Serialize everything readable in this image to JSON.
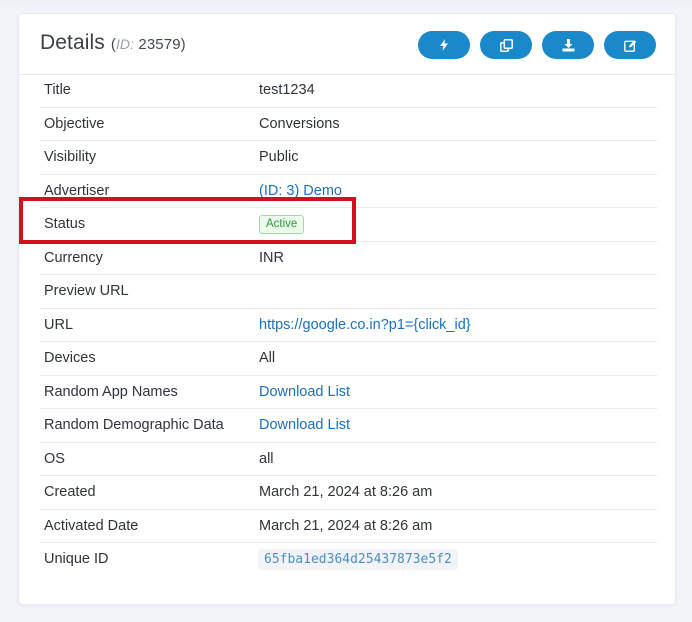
{
  "header": {
    "title": "Details",
    "id_label": "ID:",
    "id_value": "23579",
    "buttons": [
      {
        "name": "bolt-button",
        "icon": "bolt-icon"
      },
      {
        "name": "copy-button",
        "icon": "copy-icon"
      },
      {
        "name": "download-button",
        "icon": "download-icon"
      },
      {
        "name": "edit-button",
        "icon": "edit-icon"
      }
    ]
  },
  "details": {
    "title": {
      "label": "Title",
      "value": "test1234"
    },
    "objective": {
      "label": "Objective",
      "value": "Conversions"
    },
    "visibility": {
      "label": "Visibility",
      "value": "Public"
    },
    "advertiser": {
      "label": "Advertiser",
      "value": "(ID: 3) Demo"
    },
    "status": {
      "label": "Status",
      "value": "Active"
    },
    "currency": {
      "label": "Currency",
      "value": "INR"
    },
    "preview_url": {
      "label": "Preview URL",
      "value": ""
    },
    "url": {
      "label": "URL",
      "value": "https://google.co.in?p1={click_id}"
    },
    "devices": {
      "label": "Devices",
      "value": "All"
    },
    "random_app_names": {
      "label": "Random App Names",
      "value": "Download List"
    },
    "random_demographic_data": {
      "label": "Random Demographic Data",
      "value": "Download List"
    },
    "os": {
      "label": "OS",
      "value": "all"
    },
    "created": {
      "label": "Created",
      "value": "March 21, 2024 at 8:26 am"
    },
    "activated_date": {
      "label": "Activated Date",
      "value": "March 21, 2024 at 8:26 am"
    },
    "unique_id": {
      "label": "Unique ID",
      "value": "65fba1ed364d25437873e5f2"
    }
  },
  "colors": {
    "accent": "#1a89c9",
    "link": "#1b6fc2",
    "active_badge": "#2a9d3a",
    "highlight": "#d4101d"
  }
}
